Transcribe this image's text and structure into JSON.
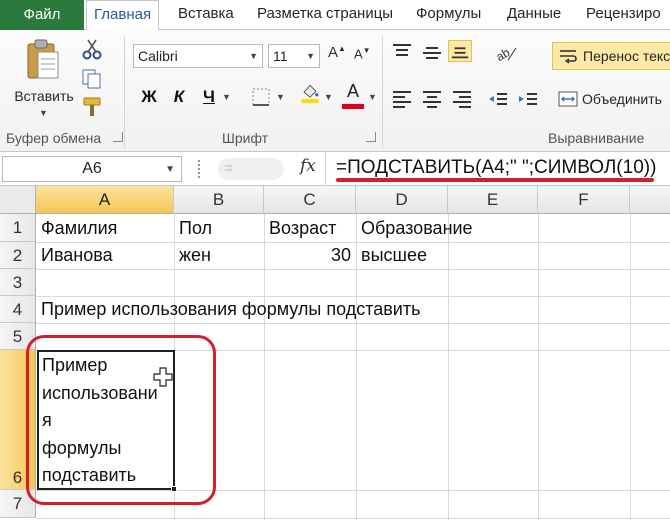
{
  "tabs": {
    "file": "Файл",
    "items": [
      "Главная",
      "Вставка",
      "Разметка страницы",
      "Формулы",
      "Данные",
      "Рецензиро"
    ]
  },
  "ribbon": {
    "clipboard": {
      "paste_label": "Вставить",
      "group_label": "Буфер обмена"
    },
    "font": {
      "font_name": "Calibri",
      "font_size": "11",
      "bold": "Ж",
      "italic": "К",
      "underline": "Ч",
      "color_letter": "A",
      "group_label": "Шрифт",
      "fill_color": "#ffd90f",
      "font_color": "#e0001b"
    },
    "alignment": {
      "wrap_text": "Перенос текс",
      "merge": "Объединить",
      "group_label": "Выравнивание"
    }
  },
  "formula_bar": {
    "name_box": "A6",
    "fx": "fx",
    "formula": "=ПОДСТАВИТЬ(A4;\" \";СИМВОЛ(10))"
  },
  "sheet": {
    "columns": [
      "A",
      "B",
      "C",
      "D",
      "E",
      "F"
    ],
    "rows": [
      "1",
      "2",
      "3",
      "4",
      "5",
      "6",
      "7"
    ],
    "cells": {
      "A1": "Фамилия",
      "B1": "Пол",
      "C1": "Возраст",
      "D1": "Образование",
      "A2": "Иванова",
      "B2": "жен",
      "C2": "30",
      "D2": "высшее",
      "A4": "Пример использования формулы подставить"
    },
    "active_cell_lines": [
      "Пример",
      "использовани",
      "я",
      "формулы",
      "подставить"
    ]
  },
  "colors": {
    "file_tab": "#2b7a3d",
    "highlight": "#d21f2b",
    "selected_header": "#f4c752"
  }
}
